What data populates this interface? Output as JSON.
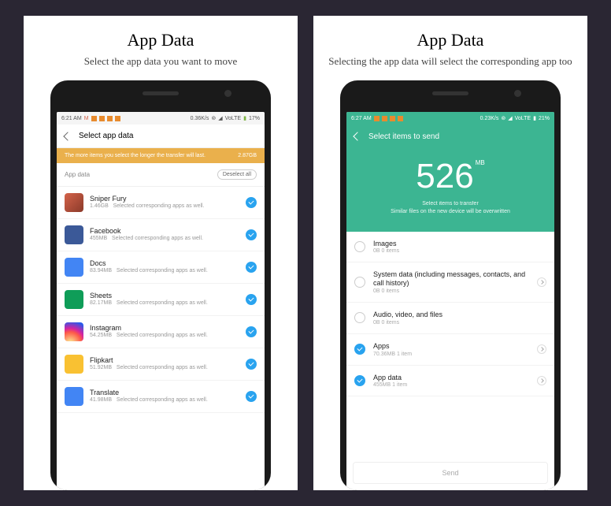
{
  "left": {
    "title": "App Data",
    "subtitle": "Select the app data you want to move",
    "status_time": "6:21 AM",
    "status_speed": "0.36K/s",
    "status_net": "VoLTE",
    "status_batt": "17%",
    "header": "Select app data",
    "banner_text": "The more items you select the longer the transfer will last.",
    "banner_size": "2.87GB",
    "section_label": "App data",
    "deselect": "Deselect all",
    "apps": [
      {
        "name": "Sniper Fury",
        "size": "1.46GB",
        "sub": "Selected corresponding apps as well."
      },
      {
        "name": "Facebook",
        "size": "455MB",
        "sub": "Selected corresponding apps as well."
      },
      {
        "name": "Docs",
        "size": "83.94MB",
        "sub": "Selected corresponding apps as well."
      },
      {
        "name": "Sheets",
        "size": "82.17MB",
        "sub": "Selected corresponding apps as well."
      },
      {
        "name": "Instagram",
        "size": "54.25MB",
        "sub": "Selected corresponding apps as well."
      },
      {
        "name": "Flipkart",
        "size": "51.92MB",
        "sub": "Selected corresponding apps as well."
      },
      {
        "name": "Translate",
        "size": "41.98MB",
        "sub": "Selected corresponding apps as well."
      }
    ]
  },
  "right": {
    "title": "App Data",
    "subtitle": "Selecting the app data will select the corresponding app too",
    "status_time": "6:27 AM",
    "status_speed": "0.23K/s",
    "status_net": "VoLTE",
    "status_batt": "21%",
    "header": "Select items to send",
    "hero_value": "526",
    "hero_unit": "MB",
    "hero_line1": "Select items to transfer",
    "hero_line2": "Similar files on the new device will be overwritten",
    "cats": [
      {
        "name": "Images",
        "sub": "0B   0 items",
        "on": false,
        "chev": false
      },
      {
        "name": "System data (including messages, contacts, and call history)",
        "sub": "0B   0 items",
        "on": false,
        "chev": true
      },
      {
        "name": "Audio, video, and files",
        "sub": "0B   0 items",
        "on": false,
        "chev": false
      },
      {
        "name": "Apps",
        "sub": "70.36MB   1 item",
        "on": true,
        "chev": true
      },
      {
        "name": "App data",
        "sub": "455MB   1 item",
        "on": true,
        "chev": true
      }
    ],
    "send": "Send"
  }
}
